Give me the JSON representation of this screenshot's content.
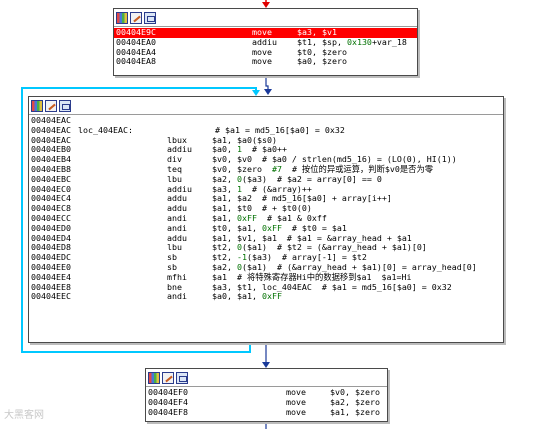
{
  "node_top": {
    "rows": [
      {
        "addr": "00404E9C",
        "mn": "move",
        "ops": "$a3, $v1",
        "highlighted": true
      },
      {
        "addr": "00404EA0",
        "mn": "addiu",
        "ops": "$t1, $sp, ",
        "num": "0x130",
        "tail": "+var_18"
      },
      {
        "addr": "00404EA4",
        "mn": "move",
        "ops": "$t0, $zero"
      },
      {
        "addr": "00404EA8",
        "mn": "move",
        "ops": "$a0, $zero"
      }
    ]
  },
  "node_loop": {
    "rows": [
      {
        "addr": "00404EAC"
      },
      {
        "addr": "00404EAC",
        "label": "loc_404EAC:",
        "cmt": "# $a1 = md5_16[$a0] = 0x32"
      },
      {
        "addr": "00404EAC",
        "mn": "lbux",
        "ops": "$a1, $a0($s0)"
      },
      {
        "addr": "00404EB0",
        "mn": "addiu",
        "ops": "$a0, ",
        "num": "1",
        "tail": "  # $a0++"
      },
      {
        "addr": "00404EB4",
        "mn": "div",
        "ops": "$v0, $v0  # $a0 / strlen(md5_16) = (LO(0), HI(1))"
      },
      {
        "addr": "00404EB8",
        "mn": "teq",
        "ops": "$v0, $zero  ",
        "num": "#7",
        "tail": "  # 按位的异或运算，判断$v0是否为零"
      },
      {
        "addr": "00404EBC",
        "mn": "lbu",
        "ops": "$a2, ",
        "num": "0",
        "tail": "($a3)  # $a2 = array[0] == 0"
      },
      {
        "addr": "00404EC0",
        "mn": "addiu",
        "ops": "$a3, ",
        "num": "1",
        "tail": "  # (&array)++"
      },
      {
        "addr": "00404EC4",
        "mn": "addu",
        "ops": "$a1, $a2  # md5_16[$a0] + array[i++]"
      },
      {
        "addr": "00404EC8",
        "mn": "addu",
        "ops": "$a1, $t0  # + $t0(0)"
      },
      {
        "addr": "00404ECC",
        "mn": "andi",
        "ops": "$a1, ",
        "num": "0xFF",
        "tail": "  # $a1 & 0xff"
      },
      {
        "addr": "00404ED0",
        "mn": "andi",
        "ops": "$t0, $a1, ",
        "num": "0xFF",
        "tail": "  # $t0 = $a1"
      },
      {
        "addr": "00404ED4",
        "mn": "addu",
        "ops": "$a1, $v1, $a1  # $a1 = &array_head + $a1"
      },
      {
        "addr": "00404ED8",
        "mn": "lbu",
        "ops": "$t2, ",
        "num": "0",
        "tail": "($a1)  # $t2 = (&array_head + $a1)[0]"
      },
      {
        "addr": "00404EDC",
        "mn": "sb",
        "ops": "$t2, ",
        "num": "-1",
        "tail": "($a3)  # array[-1] = $t2"
      },
      {
        "addr": "00404EE0",
        "mn": "sb",
        "ops": "$a2, ",
        "num": "0",
        "tail": "($a1)  # (&array_head + $a1)[0] = array_head[0]"
      },
      {
        "addr": "00404EE4",
        "mn": "mfhi",
        "ops": "$a1  # 将特殊寄存器Hi中的数据移到$a1  $a1=Hi"
      },
      {
        "addr": "00404EE8",
        "mn": "bne",
        "ops": "$a3, $t1, loc_404EAC  # $a1 = md5_16[$a0] = 0x32"
      },
      {
        "addr": "00404EEC",
        "mn": "andi",
        "ops": "$a0, $a1, ",
        "num": "0xFF"
      }
    ]
  },
  "node_bottom": {
    "rows": [
      {
        "addr": "00404EF0",
        "mn": "move",
        "ops": "$v0, $zero"
      },
      {
        "addr": "00404EF4",
        "mn": "move",
        "ops": "$a2, $zero"
      },
      {
        "addr": "00404EF8",
        "mn": "move",
        "ops": "$a1, $zero"
      }
    ]
  },
  "watermark": "大黑客网",
  "colors": {
    "highlight": "#ff0000",
    "edge_loop": "#00c8ff",
    "edge_flow": "#1a3a9a",
    "edge_in": "#e00000",
    "number": "#007000"
  }
}
